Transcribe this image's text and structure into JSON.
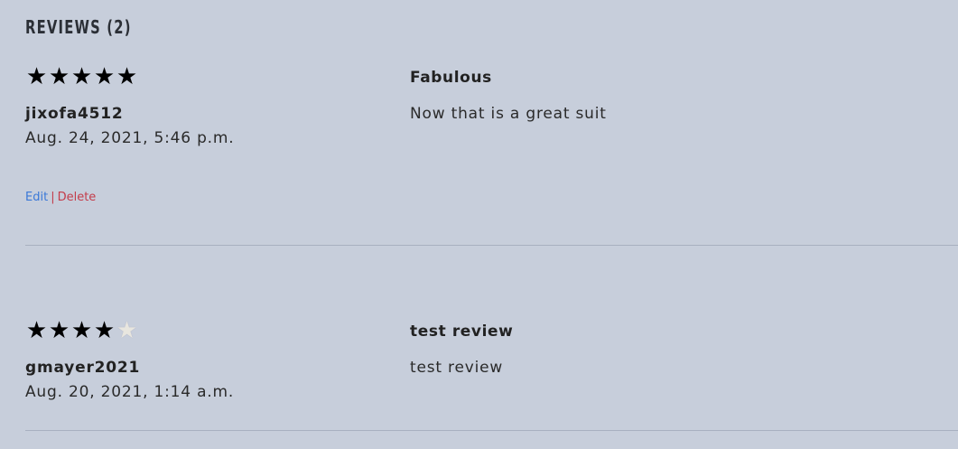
{
  "section": {
    "title": "REVIEWS (2)"
  },
  "reviews": [
    {
      "rating": 5,
      "max_rating": 5,
      "author": "jixofa4512",
      "date": "Aug. 24, 2021, 5:46 p.m.",
      "title": "Fabulous",
      "body": "Now that is a great suit",
      "actions": {
        "edit_label": "Edit",
        "separator": "|",
        "delete_label": "Delete"
      }
    },
    {
      "rating": 4,
      "max_rating": 5,
      "author": "gmayer2021",
      "date": "Aug. 20, 2021, 1:14 a.m.",
      "title": "test review",
      "body": "test review"
    }
  ],
  "colors": {
    "background": "#c7cedb",
    "star_filled": "#000000",
    "star_empty": "#e8e6df",
    "edit_link": "#3a78d8",
    "delete_link": "#c43c4a"
  },
  "icons": {
    "star_filled": "filled-star-icon",
    "star_empty": "empty-star-icon"
  }
}
